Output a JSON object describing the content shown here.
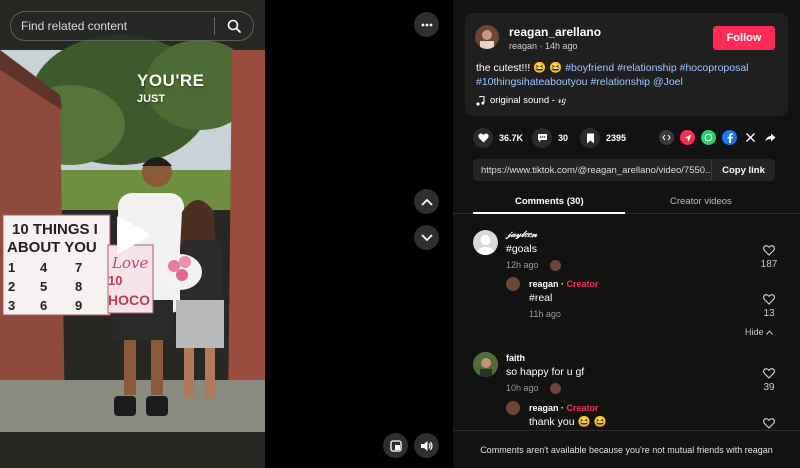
{
  "search": {
    "placeholder": "Find related content"
  },
  "video": {
    "overlay_line1": "YOU'RE",
    "overlay_line2": "JUST",
    "sign_left": "10 THINGS I ... ABOUT YOU",
    "sign_right": "Love US at HOCO"
  },
  "author": {
    "username": "reagan_arellano",
    "subline": "reagan · 14h ago",
    "follow_label": "Follow"
  },
  "caption": {
    "text": "the cutest!!! 😆 😆",
    "hashtags": [
      "#boyfriend",
      "#relationship",
      "#hocoproposal",
      "#10thingsihateaboutyou",
      "#relationship",
      "@Joel"
    ],
    "sound": "original sound - 𝓇𝑔"
  },
  "stats": {
    "likes": "36.7K",
    "comments": "30",
    "saves": "2395"
  },
  "share": {
    "url": "https://www.tiktok.com/@reagan_arellano/video/7550...",
    "copy_label": "Copy link"
  },
  "tabs": {
    "comments": "Comments (30)",
    "creator": "Creator videos"
  },
  "comments": [
    {
      "name": "𝒿𝒶𝓎𝓁𝑒𝑒𝓃",
      "text": "#goals",
      "time": "12h ago",
      "likes": "187",
      "reply": {
        "name": "reagan",
        "creator": "Creator",
        "text": "#real",
        "time": "11h ago",
        "likes": "13"
      }
    },
    {
      "name": "faith",
      "text": "so happy for u gf",
      "time": "10h ago",
      "likes": "39",
      "reply": {
        "name": "reagan",
        "creator": "Creator",
        "text": "thank you 😆 😆"
      }
    }
  ],
  "hide_label": "Hide",
  "footer": "Comments aren't available because you're not mutual friends with reagan",
  "colors": {
    "accent": "#fe2c55",
    "hashtag": "#9ec8ff",
    "panel": "#121212"
  }
}
